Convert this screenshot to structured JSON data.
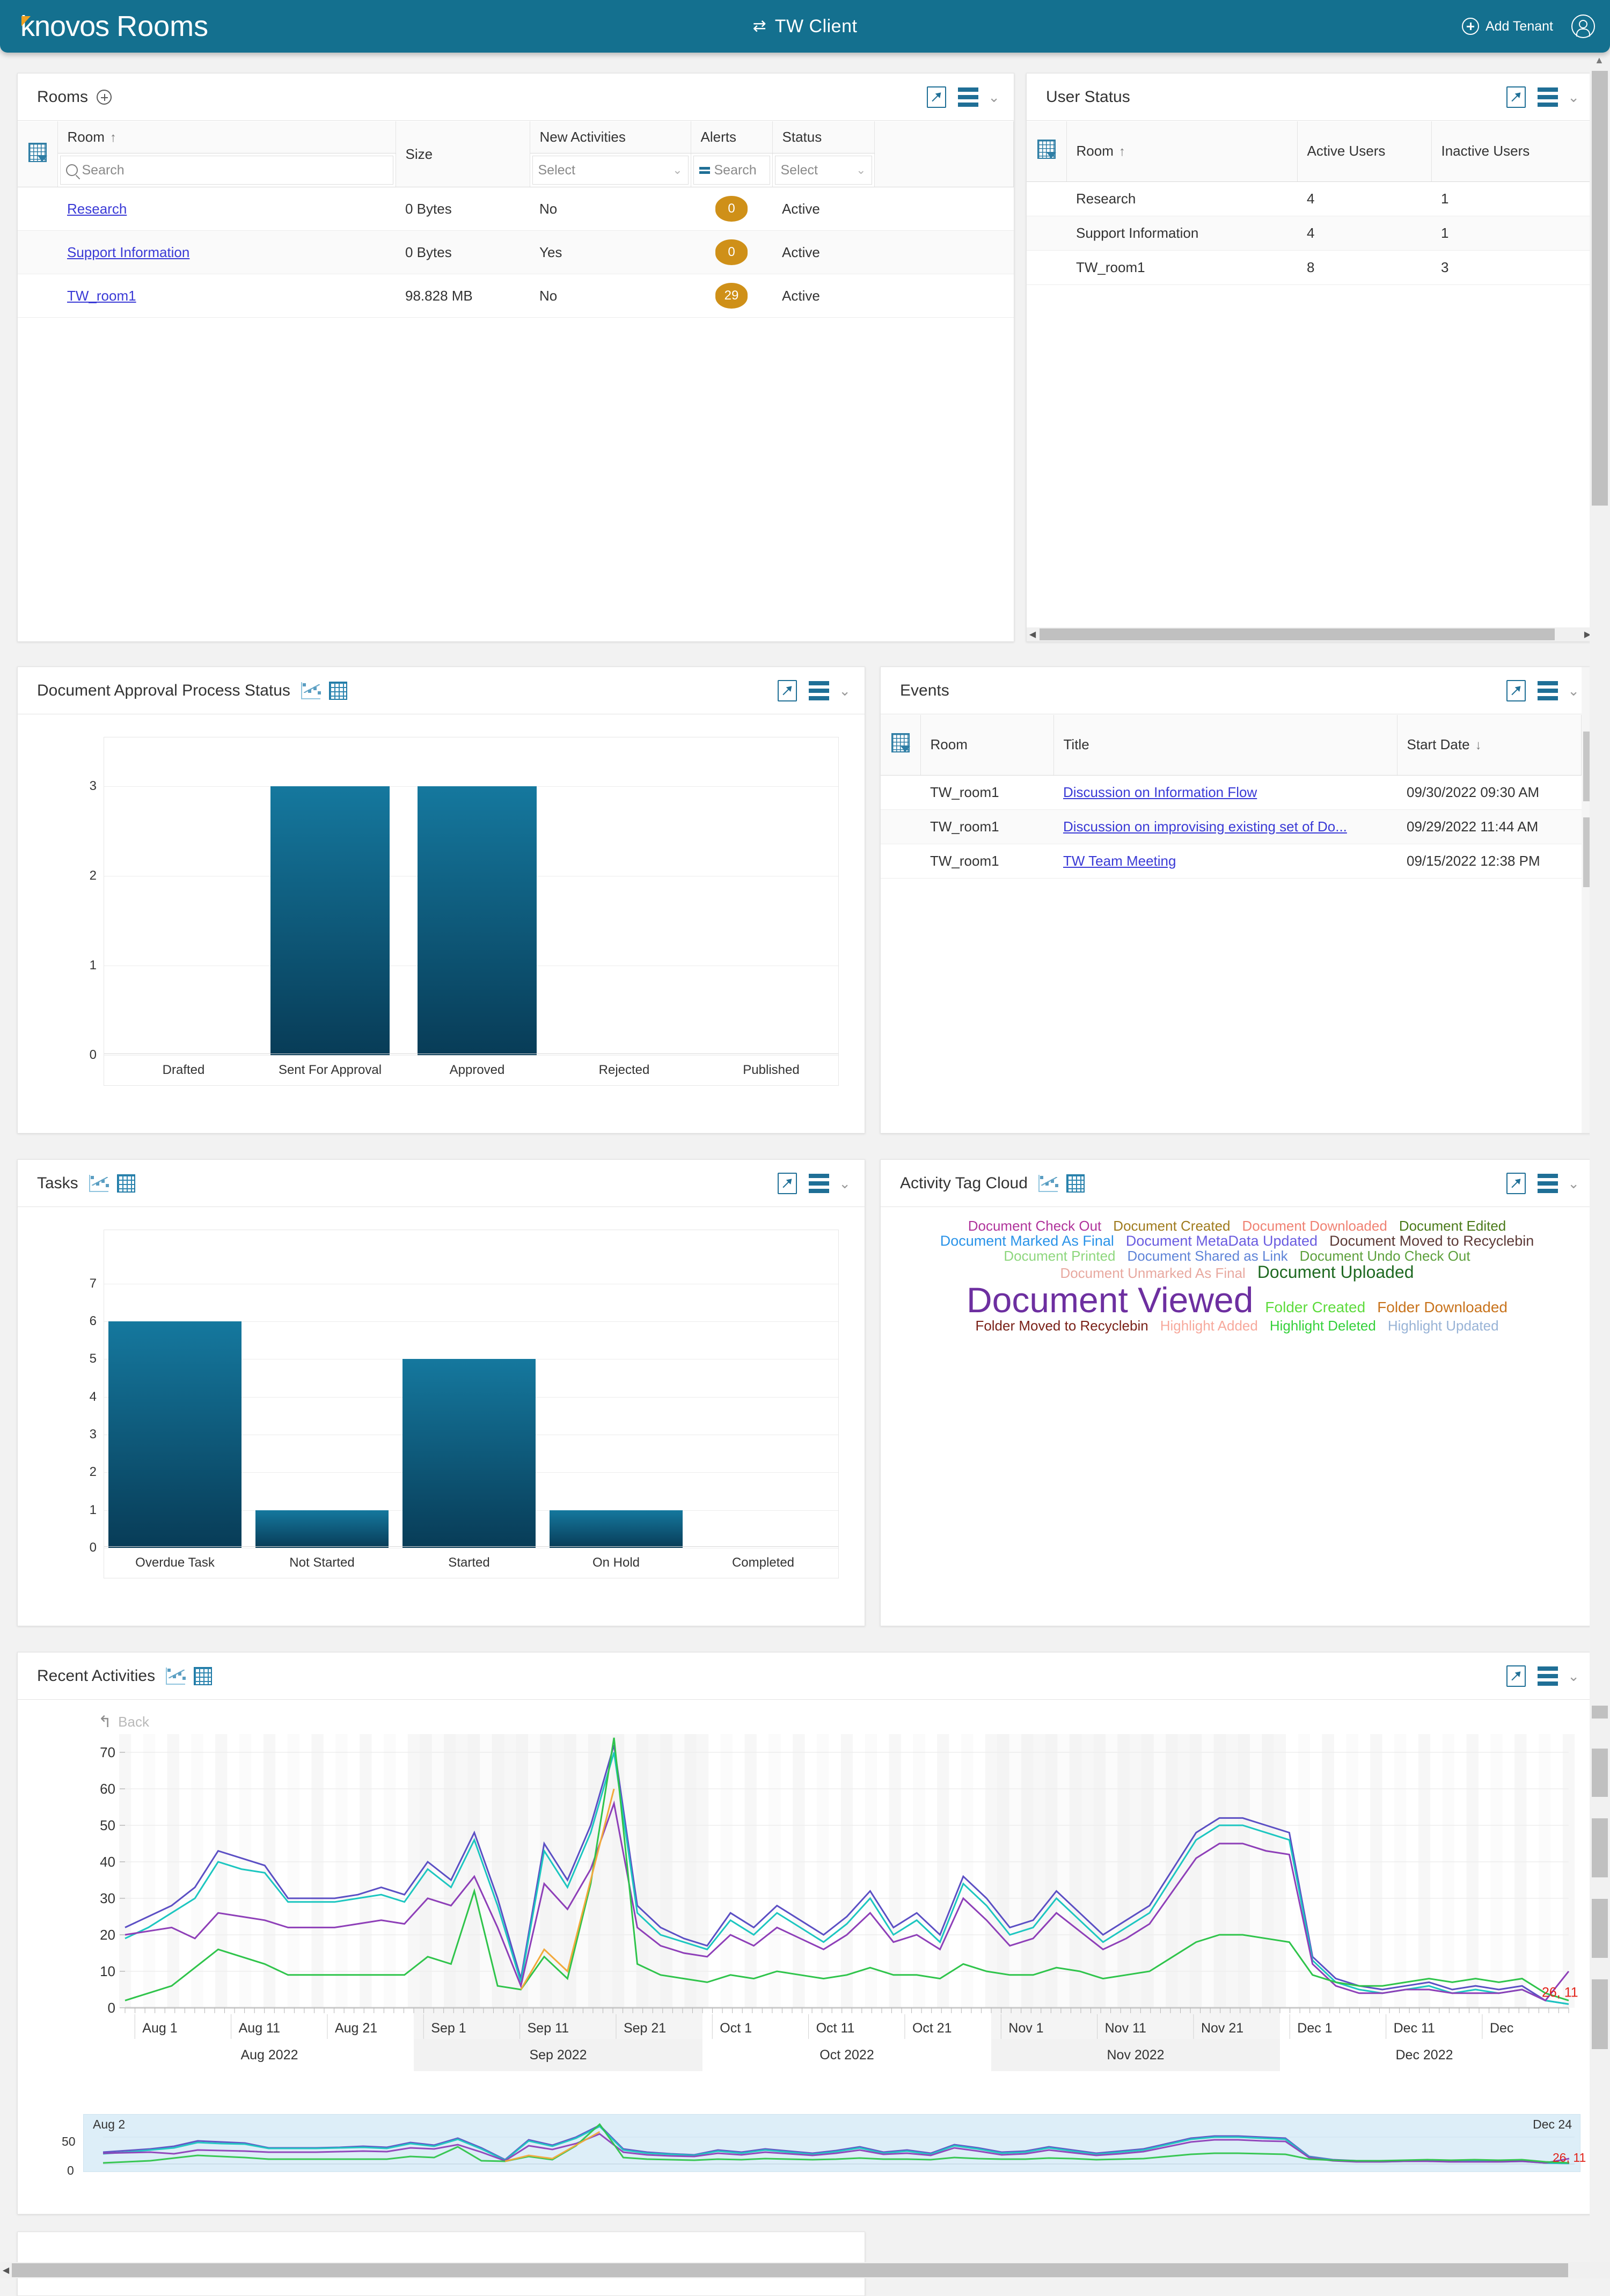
{
  "header": {
    "logo_k": "k",
    "logo_novos": "novos",
    "logo_rooms": "Rooms",
    "swap_icon": "⇄",
    "tenant_name": "TW  Client",
    "add_tenant_label": "Add Tenant"
  },
  "panels": {
    "rooms": {
      "title": "Rooms",
      "columns": [
        "Room",
        "Size",
        "New Activities",
        "Alerts",
        "Status"
      ],
      "sort": {
        "column": "Room",
        "direction": "asc"
      },
      "filters": {
        "room_placeholder": "Search",
        "new_activities": "Select",
        "alerts": "Search",
        "status": "Select"
      },
      "rows": [
        {
          "room": "Research",
          "size": "0 Bytes",
          "new_activities": "No",
          "alerts": "0",
          "status": "Active"
        },
        {
          "room": "Support Information",
          "size": "0 Bytes",
          "new_activities": "Yes",
          "alerts": "0",
          "status": "Active"
        },
        {
          "room": "TW_room1",
          "size": "98.828 MB",
          "new_activities": "No",
          "alerts": "29",
          "status": "Active"
        }
      ]
    },
    "user_status": {
      "title": "User Status",
      "columns": [
        "Room",
        "Active Users",
        "Inactive Users"
      ],
      "sort": {
        "column": "Room",
        "direction": "asc"
      },
      "rows": [
        {
          "room": "Research",
          "active": "4",
          "inactive": "1"
        },
        {
          "room": "Support Information",
          "active": "4",
          "inactive": "1"
        },
        {
          "room": "TW_room1",
          "active": "8",
          "inactive": "3"
        }
      ]
    },
    "doc_approval": {
      "title": "Document Approval Process Status"
    },
    "events": {
      "title": "Events",
      "columns": [
        "Room",
        "Title",
        "Start Date"
      ],
      "sort": {
        "column": "Start Date",
        "direction": "desc"
      },
      "rows": [
        {
          "room": "TW_room1",
          "title": "Discussion on Information Flow",
          "start": "09/30/2022 09:30 AM"
        },
        {
          "room": "TW_room1",
          "title": "Discussion on improvising existing set of Do...",
          "start": "09/29/2022 11:44 AM"
        },
        {
          "room": "TW_room1",
          "title": "TW Team Meeting",
          "start": "09/15/2022 12:38 PM"
        }
      ]
    },
    "tasks": {
      "title": "Tasks"
    },
    "tag_cloud": {
      "title": "Activity Tag Cloud"
    },
    "recent_activities": {
      "title": "Recent Activities",
      "back_label": "Back"
    }
  },
  "chart_data": [
    {
      "id": "doc_approval",
      "type": "bar",
      "title": "Document Approval Process Status",
      "categories": [
        "Drafted",
        "Sent For Approval",
        "Approved",
        "Rejected",
        "Published"
      ],
      "values": [
        0,
        3,
        3,
        0,
        0
      ],
      "yticks": [
        0,
        1,
        2,
        3
      ],
      "ylim": [
        0,
        3.8
      ],
      "xlabel": "",
      "ylabel": "",
      "grid": true,
      "legend": "none"
    },
    {
      "id": "tasks",
      "type": "bar",
      "title": "Tasks",
      "categories": [
        "Overdue Task",
        "Not Started",
        "Started",
        "On Hold",
        "Completed"
      ],
      "values": [
        6,
        1,
        5,
        1,
        0
      ],
      "yticks": [
        0,
        1,
        2,
        3,
        4,
        5,
        6,
        7
      ],
      "ylim": [
        0,
        7.5
      ],
      "xlabel": "",
      "ylabel": "",
      "grid": true,
      "legend": "none"
    },
    {
      "id": "recent_activities",
      "type": "line",
      "title": "Recent Activities",
      "yticks": [
        0,
        10,
        20,
        30,
        40,
        50,
        60,
        70
      ],
      "ylim": [
        0,
        75
      ],
      "xtick_labels": [
        "Aug 1",
        "Aug 11",
        "Aug 21",
        "Sep 1",
        "Sep 11",
        "Sep 21",
        "Oct 1",
        "Oct 11",
        "Oct 21",
        "Nov 1",
        "Nov 11",
        "Nov 21",
        "Dec 1",
        "Dec 11",
        "Dec"
      ],
      "month_bands": [
        "Aug 2022",
        "Sep 2022",
        "Oct 2022",
        "Nov 2022",
        "Dec 2022"
      ],
      "navigator": {
        "start_label": "Aug 2",
        "end_label": "Dec 24",
        "ytick": "50",
        "ytick0": "0"
      },
      "end_annotation": "26, 11",
      "series": [
        {
          "name": "series-1",
          "color": "#5b4fc4"
        },
        {
          "name": "series-2",
          "color": "#1cc6c0"
        },
        {
          "name": "series-3",
          "color": "#8e3fb8"
        },
        {
          "name": "series-4",
          "color": "#2fc44b"
        },
        {
          "name": "series-5",
          "color": "#f2a93b"
        }
      ]
    }
  ],
  "tag_cloud_data": {
    "type": "tag-cloud",
    "rows": [
      [
        {
          "text": "Document Check Out",
          "color": "#b0349b",
          "size": 26
        },
        {
          "text": "Document Created",
          "color": "#a07b1e",
          "size": 26
        },
        {
          "text": "Document Downloaded",
          "color": "#f08273",
          "size": 26
        },
        {
          "text": "Document Edited",
          "color": "#4a7a19",
          "size": 26
        }
      ],
      [
        {
          "text": "Document Marked As Final",
          "color": "#2a93e8",
          "size": 27
        },
        {
          "text": "Document MetaData Updated",
          "color": "#6a5ce0",
          "size": 27
        },
        {
          "text": "Document Moved to Recyclebin",
          "color": "#5c3a37",
          "size": 27
        }
      ],
      [
        {
          "text": "Document Printed",
          "color": "#8ed77e",
          "size": 26
        },
        {
          "text": "Document Shared as Link",
          "color": "#5f84d8",
          "size": 26
        },
        {
          "text": "Document Undo Check Out",
          "color": "#5da03c",
          "size": 26
        }
      ],
      [
        {
          "text": "Document Unmarked As Final",
          "color": "#e8a9a0",
          "size": 26
        },
        {
          "text": "Document Uploaded",
          "color": "#1f6a22",
          "size": 32
        }
      ],
      [
        {
          "text": "Document Viewed",
          "color": "#6d2fa0",
          "size": 66
        },
        {
          "text": "Folder Created",
          "color": "#5ddb3c",
          "size": 28
        },
        {
          "text": "Folder Downloaded",
          "color": "#c8731c",
          "size": 28
        }
      ],
      [
        {
          "text": "Folder Moved to Recyclebin",
          "color": "#7a2118",
          "size": 26
        },
        {
          "text": "Highlight Added",
          "color": "#f7a99c",
          "size": 26
        },
        {
          "text": "Highlight Deleted",
          "color": "#34d13a",
          "size": 26
        },
        {
          "text": "Highlight Updated",
          "color": "#98b3d6",
          "size": 26
        }
      ]
    ]
  }
}
